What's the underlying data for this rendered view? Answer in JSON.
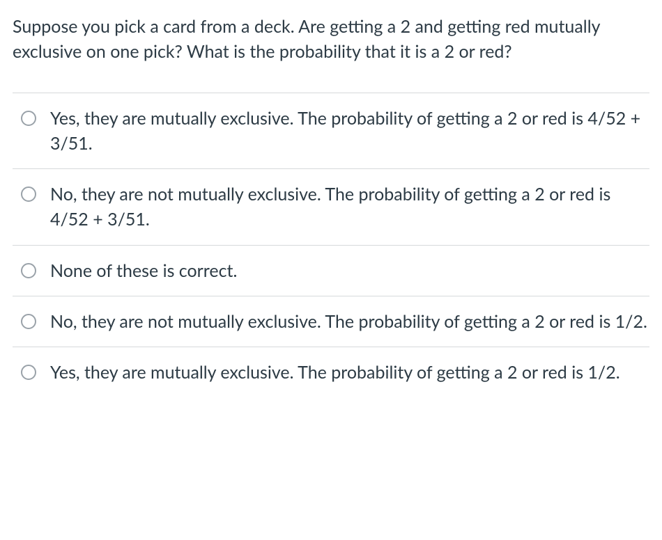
{
  "question": {
    "text": "Suppose you pick a card from a deck. Are getting a 2 and getting red mutually exclusive on one pick? What is the probability that it is a 2 or red?"
  },
  "options": [
    {
      "label": "Yes, they are mutually exclusive. The probability of getting a 2 or red is 4/52 + 3/51."
    },
    {
      "label": "No, they are not mutually exclusive. The probability of getting a 2 or red is 4/52 + 3/51."
    },
    {
      "label": "None of these is correct."
    },
    {
      "label": "No, they are not mutually exclusive. The probability of getting a 2 or red is 1/2."
    },
    {
      "label": "Yes, they are mutually exclusive. The probability of getting a 2 or red is 1/2."
    }
  ]
}
